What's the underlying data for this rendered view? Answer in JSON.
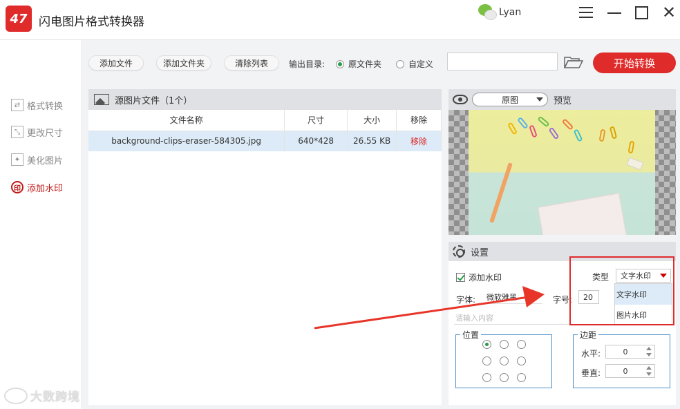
{
  "app": {
    "title": "闪电图片格式转换器",
    "logo_text": "47",
    "user": "Lyan"
  },
  "window_controls": {
    "close_glyph": "✕"
  },
  "sidebar": {
    "items": [
      {
        "label": "格式转换",
        "icon": "format-convert-icon"
      },
      {
        "label": "更改尺寸",
        "icon": "resize-icon"
      },
      {
        "label": "美化图片",
        "icon": "beautify-icon"
      },
      {
        "label": "添加水印",
        "icon": "watermark-icon",
        "icon_text": "印",
        "active": true
      }
    ]
  },
  "toolbar": {
    "add_file": "添加文件",
    "add_folder": "添加文件夹",
    "clear_list": "清除列表",
    "output_label": "输出目录:",
    "radio_original": "原文件夹",
    "radio_custom": "自定义",
    "path_value": "",
    "start": "开始转换"
  },
  "file_panel": {
    "title": "源图片文件（1个）",
    "columns": [
      "文件名称",
      "尺寸",
      "大小",
      "移除"
    ],
    "rows": [
      {
        "name": "background-clips-eraser-584305.jpg",
        "size": "640*428",
        "filesize": "26.55 KB",
        "remove": "移除"
      }
    ]
  },
  "preview": {
    "mode": "原图",
    "label": "预览"
  },
  "settings": {
    "title": "设置",
    "add_watermark": "添加水印",
    "type_label": "类型",
    "type_value": "文字水印",
    "type_options": [
      "文字水印",
      "图片水印"
    ],
    "font_label": "字体:",
    "font_value": "微软雅黑",
    "size_label": "字号:",
    "size_value": "20",
    "text_placeholder": "请输入内容",
    "position_label": "位置",
    "margin_label": "边距",
    "horizontal_label": "水平:",
    "horizontal_value": "0",
    "vertical_label": "垂直:",
    "vertical_value": "0"
  },
  "watermark_overlay": "大数跨境",
  "colors": {
    "accent": "#e02b2b",
    "panel_header": "#dfe1e5",
    "selected_row": "#dcebf7",
    "check": "#2a9d49"
  }
}
